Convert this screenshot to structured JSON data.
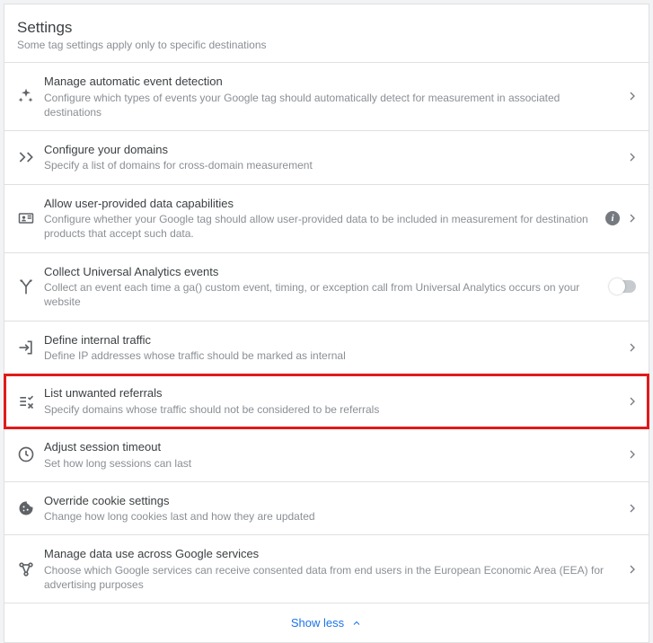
{
  "header": {
    "title": "Settings",
    "subtitle": "Some tag settings apply only to specific destinations"
  },
  "items": [
    {
      "title": "Manage automatic event detection",
      "desc": "Configure which types of events your Google tag should automatically detect for measurement in associated destinations"
    },
    {
      "title": "Configure your domains",
      "desc": "Specify a list of domains for cross-domain measurement"
    },
    {
      "title": "Allow user-provided data capabilities",
      "desc": "Configure whether your Google tag should allow user-provided data to be included in measurement for destination products that accept such data."
    },
    {
      "title": "Collect Universal Analytics events",
      "desc": "Collect an event each time a ga() custom event, timing, or exception call from Universal Analytics occurs on your website"
    },
    {
      "title": "Define internal traffic",
      "desc": "Define IP addresses whose traffic should be marked as internal"
    },
    {
      "title": "List unwanted referrals",
      "desc": "Specify domains whose traffic should not be considered to be referrals"
    },
    {
      "title": "Adjust session timeout",
      "desc": "Set how long sessions can last"
    },
    {
      "title": "Override cookie settings",
      "desc": "Change how long cookies last and how they are updated"
    },
    {
      "title": "Manage data use across Google services",
      "desc": "Choose which Google services can receive consented data from end users in the European Economic Area (EEA) for advertising purposes"
    }
  ],
  "show_less": "Show less"
}
